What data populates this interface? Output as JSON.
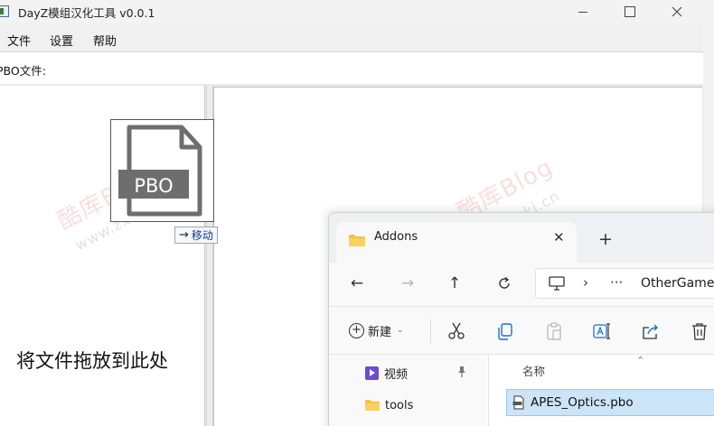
{
  "app": {
    "title": "DayZ模组汉化工具 v0.0.1",
    "menu": {
      "file": "文件",
      "settings": "设置",
      "help": "帮助"
    },
    "pbo_label": "PBO文件:",
    "drop_hint": "将文件拖放到此处"
  },
  "drag": {
    "icon_text": "PBO",
    "tooltip": "移动"
  },
  "watermark": {
    "logo_1": "酷库Blog",
    "url_1": "www.zxki.cn",
    "logo_2": "酷库Blog",
    "url_2": "www.zxki.cn"
  },
  "explorer": {
    "tab_title": "Addons",
    "address_text": "OtherGame",
    "new_label": "新建",
    "nav_items": [
      {
        "label": "视频"
      },
      {
        "label": "tools"
      }
    ],
    "column_name": "名称",
    "file": {
      "name": "APES_Optics.pbo"
    }
  },
  "colors": {
    "selection": "#cce4f7",
    "selection_border": "#99c9ef",
    "folder": "#f4c23d",
    "pbo_band": "#6e6e6e",
    "videos_icon": "#6c4bd6"
  }
}
